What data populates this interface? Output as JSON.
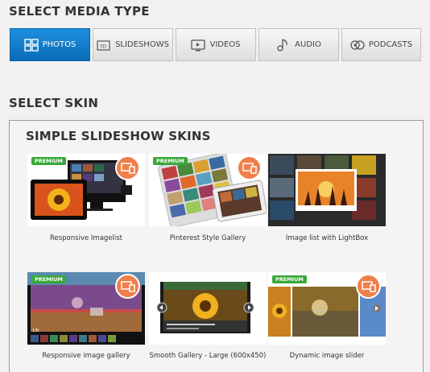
{
  "headings": {
    "media_type": "SELECT MEDIA TYPE",
    "skin": "SELECT SKIN"
  },
  "tabs": [
    {
      "label": "PHOTOS",
      "icon": "photos-grid-icon",
      "active": true
    },
    {
      "label": "SLIDESHOWS",
      "icon": "slideshow-3d-icon",
      "active": false
    },
    {
      "label": "VIDEOS",
      "icon": "video-monitor-icon",
      "active": false
    },
    {
      "label": "AUDIO",
      "icon": "audio-note-icon",
      "active": false
    },
    {
      "label": "PODCASTS",
      "icon": "podcast-icon",
      "active": false
    }
  ],
  "panel": {
    "title": "SIMPLE SLIDESHOW SKINS",
    "premium_label": "PREMIUM",
    "skins": [
      {
        "caption": "Responsive Imagelist",
        "premium": true,
        "responsive": true
      },
      {
        "caption": "Pinterest Style Gallery",
        "premium": true,
        "responsive": true
      },
      {
        "caption": "Image list with LightBox",
        "premium": false,
        "responsive": false
      },
      {
        "caption": "Responsive image gallery",
        "premium": true,
        "responsive": true
      },
      {
        "caption": "Smooth Gallery - Large (600x450)",
        "premium": false,
        "responsive": false
      },
      {
        "caption": "Dynamic image slider",
        "premium": true,
        "responsive": true
      }
    ]
  },
  "colors": {
    "active_tab": "#1a80d0",
    "premium_badge": "#3aa83a",
    "responsive_badge": "#f07f4a"
  }
}
